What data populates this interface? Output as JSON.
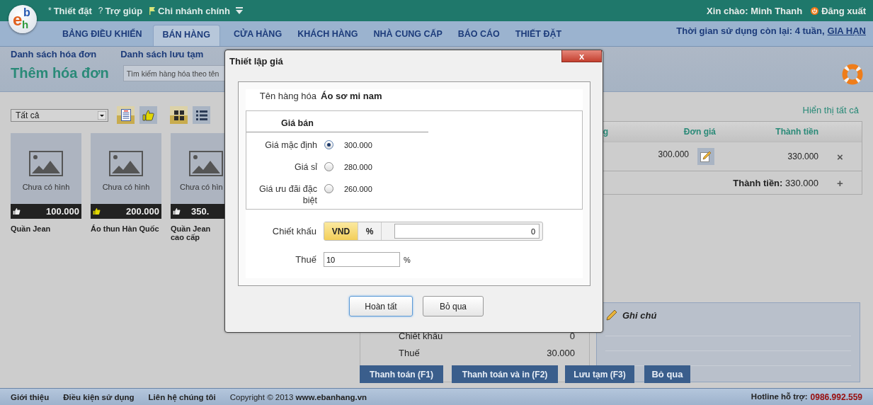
{
  "top_bar": {
    "logo": [
      {
        "char": "e",
        "color": "#e0601e"
      },
      {
        "char": "b",
        "color": "#2457b0"
      },
      {
        "char": "h",
        "color": "#2f9a3c"
      }
    ],
    "links": [
      {
        "kind": "glyph",
        "glyph": "*",
        "label": "Thiết đặt"
      },
      {
        "kind": "glyph",
        "glyph": "?",
        "label": "Trợ giúp"
      },
      {
        "kind": "branch",
        "label": "Chi nhánh chính",
        "dropdown": true
      }
    ],
    "greeting": "Xin chào: Minh Thanh",
    "logout": "Đăng xuất"
  },
  "nav": {
    "tabs": [
      {
        "label": "BẢNG ĐIỀU KHIỂN",
        "selected": false
      },
      {
        "label": "BÁN HÀNG",
        "selected": true
      },
      {
        "label": "CỬA HÀNG",
        "selected": false
      },
      {
        "label": "KHÁCH HÀNG",
        "selected": false
      },
      {
        "label": "NHÀ CUNG CẤP",
        "selected": false
      },
      {
        "label": "BÁO CÁO",
        "selected": false
      },
      {
        "label": "THIẾT ĐẶT",
        "selected": false
      }
    ],
    "remaining": "Thời gian sử dụng còn lại: 4 tuần,",
    "renew_link": "GIA HẠN"
  },
  "sub_header": {
    "links": [
      "Danh sách hóa đơn",
      "Danh sách lưu tạm"
    ],
    "title": "Thêm hóa đơn",
    "search": {
      "placeholder": "Tìm kiếm hàng hóa theo tên"
    }
  },
  "products": {
    "filter": "Tất cả",
    "toggles": [
      {
        "kind": "document",
        "selected": true
      },
      {
        "kind": "thumbs",
        "selected": false
      },
      {
        "kind": "grid",
        "selected": true
      },
      {
        "kind": "list",
        "selected": false
      }
    ],
    "items": [
      {
        "image_text": "Chưa có hình",
        "price": "100.000",
        "liked": false,
        "name": "Quần Jean"
      },
      {
        "image_text": "Chưa có hình",
        "price": "200.000",
        "liked": true,
        "name": "Áo thun Hàn Quốc"
      },
      {
        "image_text": "Chưa có hìn",
        "price": "350.",
        "liked": false,
        "name": "Quần Jean cao cấp"
      }
    ]
  },
  "order": {
    "show_all": "Hiển thị tất cả",
    "columns": [
      "g",
      "Đơn giá",
      "Thành tiền"
    ],
    "rows": [
      {
        "unit_price": "300.000",
        "line_total": "330.000",
        "remove": "×"
      }
    ],
    "total": "**Thành tiền:** 330.000",
    "add": "+"
  },
  "summary": [
    {
      "label": "Chiết khấu",
      "value": "0"
    },
    {
      "label": "Thuế",
      "value": "30.000"
    }
  ],
  "notes": {
    "title": "Ghi chú"
  },
  "actions": [
    "Thanh toán (F1)",
    "Thanh toán và in (F2)",
    "Lưu tạm (F3)",
    "Bỏ qua"
  ],
  "footer": {
    "links": [
      "Giới thiệu",
      "Điều kiện sử dụng",
      "Liên hệ chúng tôi"
    ],
    "copyright": "Copyright © 2013 **www.ebanhang.vn**",
    "hotline_label": "Hotline hỗ trợ:",
    "hotline": "0986.992.559"
  },
  "dialog": {
    "title": "Thiết lập giá",
    "close": "x",
    "product_label": "Tên hàng hóa",
    "product_name": "Áo sơ mi nam",
    "price_group": "Giá bán",
    "price_options": [
      {
        "label": "Giá mặc định",
        "value": "300.000",
        "selected": true
      },
      {
        "label": "Giá sỉ",
        "value": "280.000",
        "selected": false
      },
      {
        "label": "Giá ưu đãi đặc biệt",
        "value": "260.000",
        "selected": false
      }
    ],
    "discount_label": "Chiết khấu",
    "discount_units": [
      {
        "label": "VND",
        "selected": true
      },
      {
        "label": "%",
        "selected": false
      }
    ],
    "discount_value": "0",
    "tax_label": "Thuế",
    "tax_value": "10",
    "tax_unit": "%",
    "buttons": [
      {
        "label": "Hoàn tất",
        "kind": "primary"
      },
      {
        "label": "Bỏ qua",
        "kind": "normal"
      }
    ]
  }
}
